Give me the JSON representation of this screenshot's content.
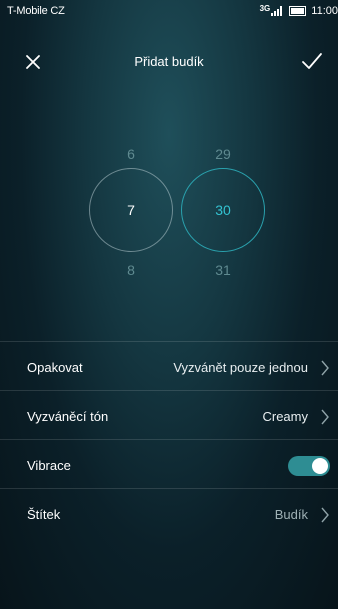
{
  "status_bar": {
    "carrier": "T-Mobile CZ",
    "network": "3G",
    "time": "11:00"
  },
  "header": {
    "title": "Přidat budík",
    "close_icon": "close-icon",
    "confirm_icon": "checkmark-icon"
  },
  "time_picker": {
    "hour": {
      "prev": "6",
      "current": "7",
      "next": "8"
    },
    "minute": {
      "prev": "29",
      "current": "30",
      "next": "31"
    },
    "accent_color": "#33c3d1"
  },
  "settings": {
    "repeat": {
      "label": "Opakovat",
      "value": "Vyzvánět pouze jednou"
    },
    "ringtone": {
      "label": "Vyzváněcí tón",
      "value": "Creamy"
    },
    "vibration": {
      "label": "Vibrace",
      "enabled": true
    },
    "tag": {
      "label": "Štítek",
      "value": "Budík"
    }
  }
}
